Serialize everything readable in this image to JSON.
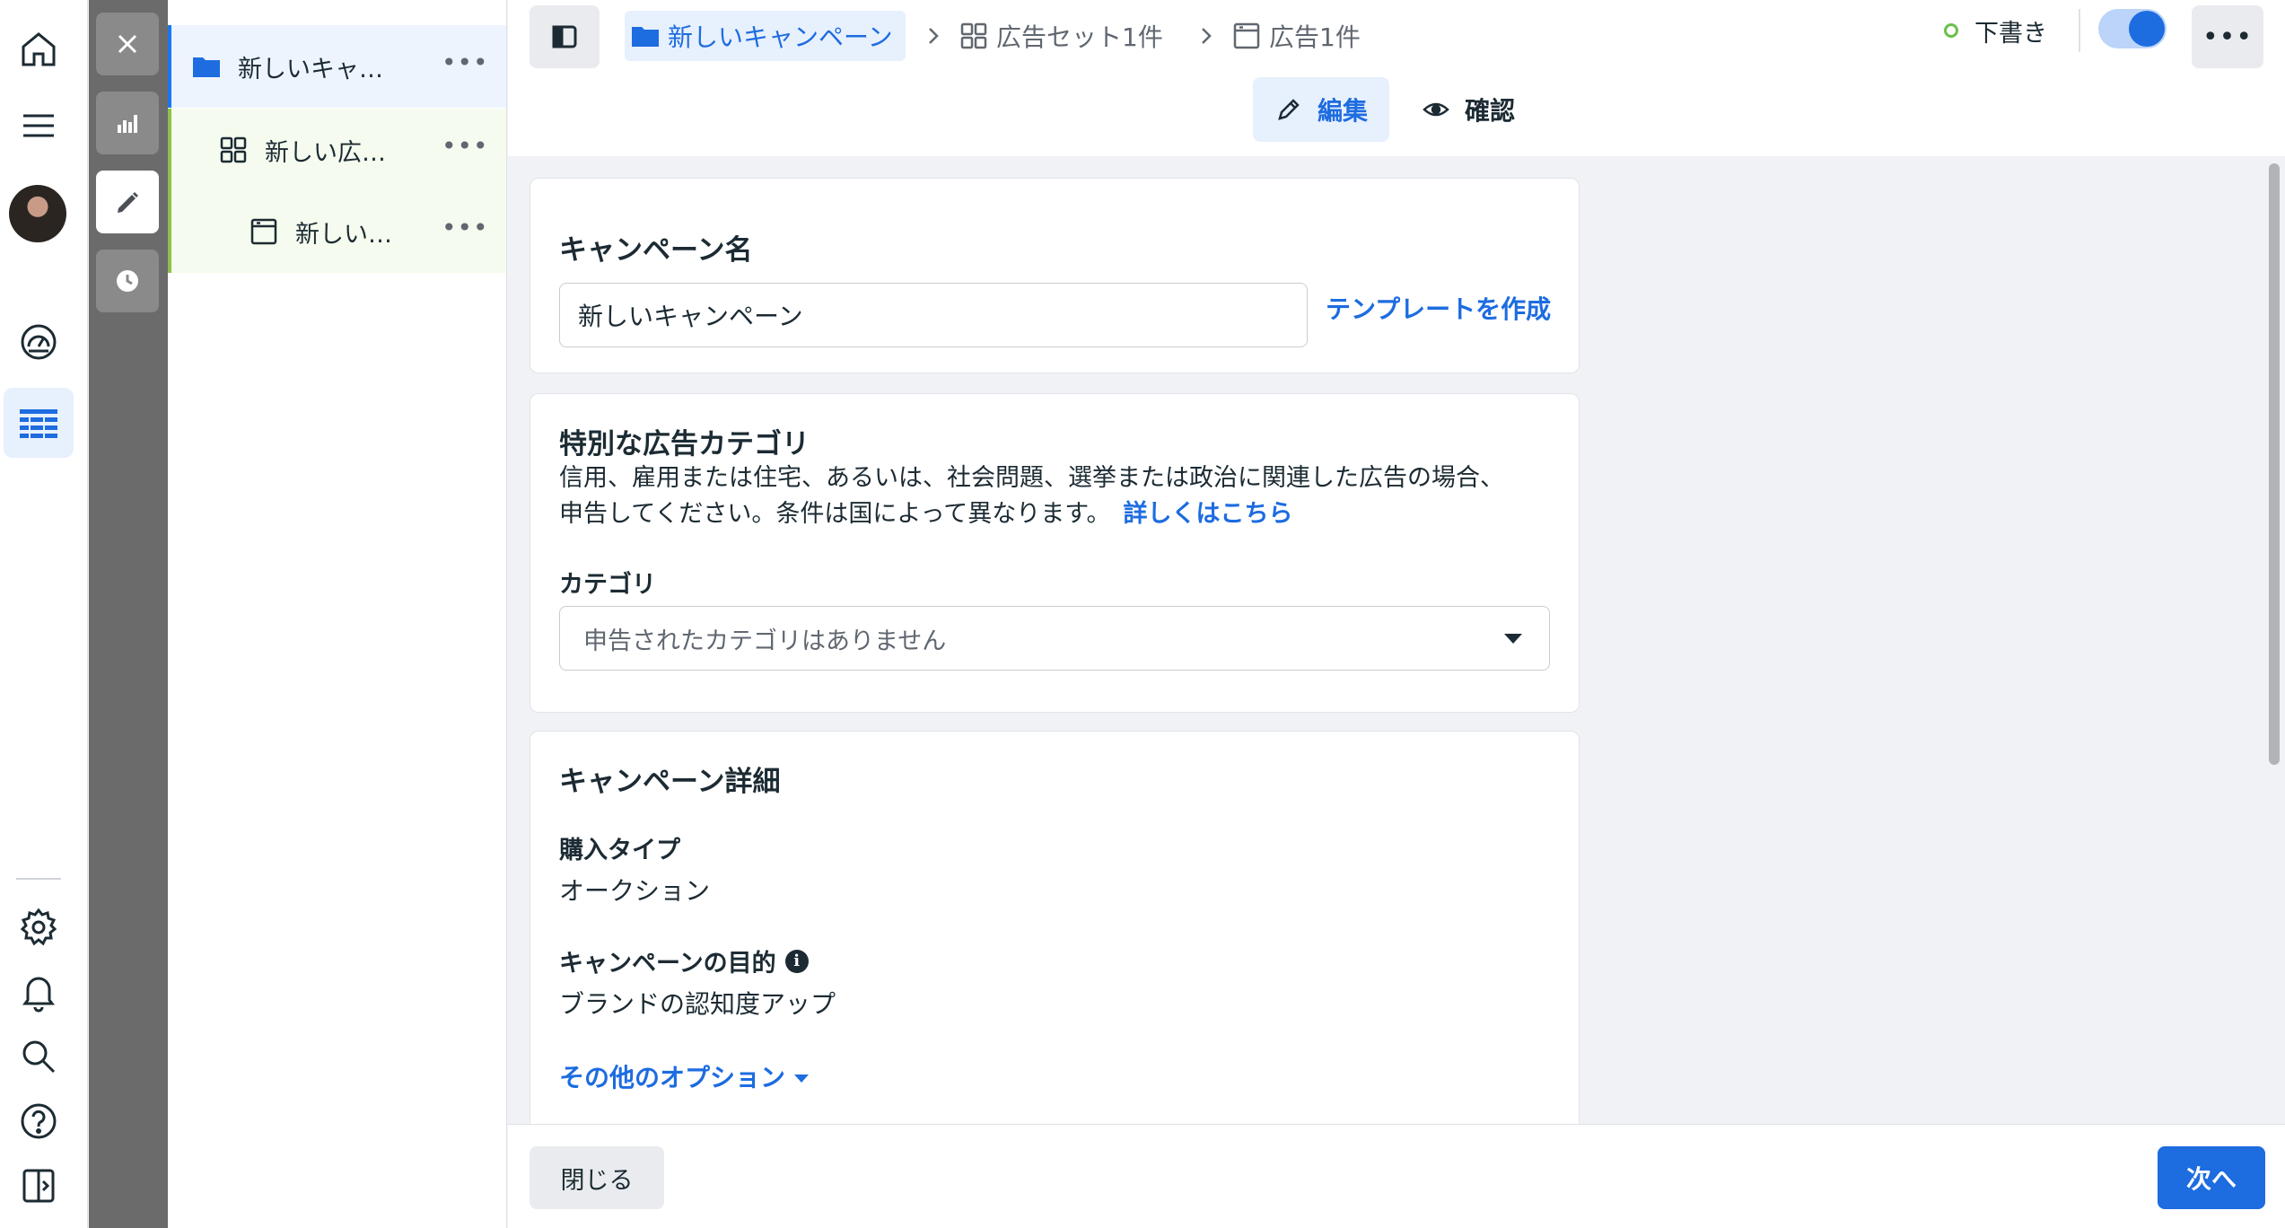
{
  "tree": {
    "campaign_label": "新しいキャ…",
    "adset_label": "新しい広…",
    "ad_label": "新しい…",
    "more_glyph": "•••"
  },
  "header": {
    "breadcrumb": {
      "campaign": "新しいキャンペーン",
      "adset": "広告セット1件",
      "ad": "広告1件"
    },
    "status": "下書き",
    "more_glyph": "•••",
    "tabs": {
      "edit": "編集",
      "review": "確認"
    }
  },
  "campaign_name_card": {
    "title": "キャンペーン名",
    "input_value": "新しいキャンペーン",
    "template_link": "テンプレートを作成"
  },
  "special_category_card": {
    "title": "特別な広告カテゴリ",
    "description_line1": "信用、雇用または住宅、あるいは、社会問題、選挙または政治に関連した広告の場合、",
    "description_line2": "申告してください。条件は国によって異なります。",
    "learn_more": "詳しくはこちら",
    "category_label": "カテゴリ",
    "category_value": "申告されたカテゴリはありません"
  },
  "campaign_details_card": {
    "title": "キャンペーン詳細",
    "buy_type_label": "購入タイプ",
    "buy_type_value": "オークション",
    "objective_label": "キャンペーンの目的",
    "objective_value": "ブランドの認知度アップ",
    "more_options": "その他のオプション",
    "info_glyph": "i"
  },
  "footer": {
    "close": "閉じる",
    "next": "次へ"
  },
  "colors": {
    "accent": "#1d6ce0",
    "campaign_highlight": "#eef4fe",
    "adset_highlight": "#f5fbee",
    "draft_status": "#6cc04a",
    "tool_strip": "#6b6b6b"
  },
  "icons": {
    "rail": [
      "home-icon",
      "menu-icon",
      "avatar",
      "gauge-icon",
      "grid-table-icon",
      "gear-icon",
      "bell-icon",
      "search-icon",
      "help-icon",
      "panel-icon"
    ],
    "tools": [
      "close-icon",
      "chart-icon",
      "pencil-icon",
      "clock-icon"
    ]
  }
}
